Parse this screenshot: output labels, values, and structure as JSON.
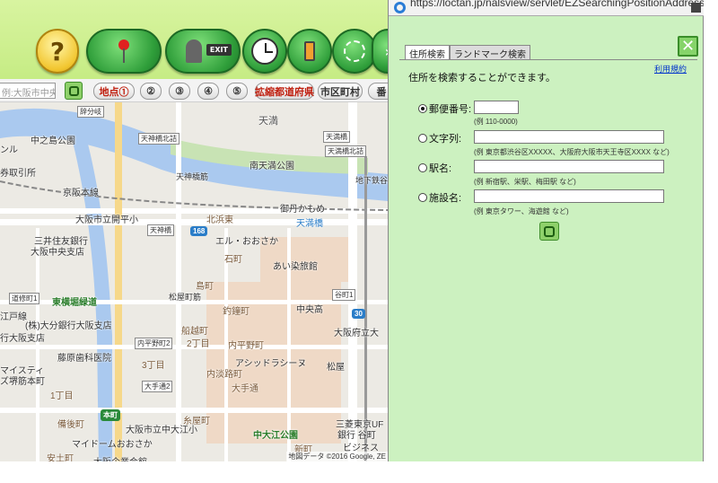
{
  "toolbar": {
    "help_glyph": "?",
    "exit_label": "EXIT"
  },
  "toolbar2": {
    "search_value": "例:大阪市中央",
    "buttons": [
      "地点①",
      "②",
      "③",
      "④",
      "⑤",
      "拡縮都道府県",
      "市区町村",
      "番"
    ]
  },
  "map": {
    "labels": [
      "天満",
      "中之島公園",
      "南天満公園",
      "京阪本線",
      "御丹かもめ",
      "天満橋",
      "大阪市立開平小",
      "北浜東",
      "エル・おおさか",
      "石町",
      "三井住友銀行",
      "大阪中央支店",
      "あい染旅館",
      "東横堀緑道",
      "島町",
      "釣鐘町",
      "中央高",
      "大阪府立大",
      "(株)大分銀行大阪支店",
      "行大阪支店",
      "船越町",
      "2丁目",
      "内平野町",
      "藤原歯科医院",
      "3丁目",
      "アシッドラシーヌ",
      "松屋",
      "マイスティ",
      "ズ堺筋本町",
      "内淡路町",
      "大手通",
      "1丁目",
      "糸屋町",
      "備後町",
      "大阪市立中大江小",
      "中大江公園",
      "三菱東京UF",
      "銀行 谷町",
      "マイドームおおさか",
      "新町",
      "ビジネス",
      "安土町",
      "大阪企業会館",
      "ンル",
      "券取引所",
      "江戸線",
      "天神橋筋",
      "松屋町筋",
      "地下鉄谷町線"
    ],
    "boxes": [
      "天神橋北詰",
      "天満橋北詰",
      "天満橋",
      "天神橋",
      "道修町1",
      "内平野町2",
      "大手通2",
      "谷町1",
      "辞分岐"
    ],
    "badges": [
      "168",
      "30",
      "本町"
    ],
    "copyright": "地図データ ©2016 Google, ZE"
  },
  "popup": {
    "url": "https://loctan.jp/nalsview/servlet/EZSearchingPositionAddressDis",
    "tabs": [
      "住所検索",
      "ランドマーク検索"
    ],
    "close_glyph": "✕",
    "terms_link": "利用規約",
    "intro": "住所を検索することができます。",
    "options": [
      {
        "label": "郵便番号:",
        "checked": true,
        "hint": "(例 110-0000)"
      },
      {
        "label": "文字列:",
        "checked": false,
        "hint": "(例 東京都渋谷区XXXXX、大阪府大阪市天王寺区XXXX など)"
      },
      {
        "label": "駅名:",
        "checked": false,
        "hint": "(例 新宿駅、栄駅、梅田駅 など)"
      },
      {
        "label": "施設名:",
        "checked": false,
        "hint": "(例 東京タワー、海遊館 など)"
      }
    ]
  },
  "colors": {
    "panel_bg": "#ccf1c0",
    "toolbar_bg": "#c6ec84",
    "button_green": "#2f9e3a",
    "link_blue": "#0033cc"
  }
}
